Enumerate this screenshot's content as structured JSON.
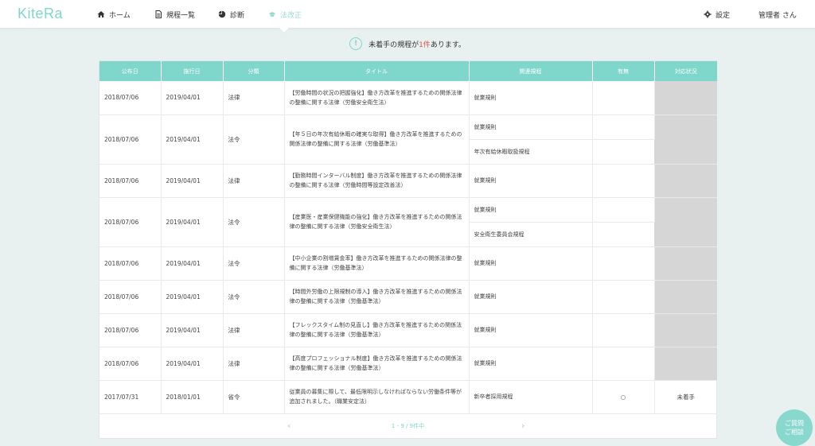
{
  "app": {
    "logo": "KiteRa"
  },
  "nav": {
    "home": "ホーム",
    "list": "規程一覧",
    "diagnosis": "診断",
    "law": "法改正",
    "settings": "設定",
    "user": "管理者 さん"
  },
  "notice": {
    "prefix": "未着手の規程が",
    "count": "1件",
    "suffix": "あります。",
    "icon": "!"
  },
  "table": {
    "headers": [
      "公布日",
      "施行日",
      "分類",
      "タイトル",
      "関連規程",
      "有無",
      "対応状況"
    ],
    "rows": [
      {
        "pub": "2018/07/06",
        "eff": "2019/04/01",
        "cat": "法律",
        "title": "【労働時間の状況の把握強化】働き方改革を推進するための関係法律の整備に関する法律（労働安全衛生法）",
        "related": [
          "就業規則"
        ],
        "has": "",
        "status": ""
      },
      {
        "pub": "2018/07/06",
        "eff": "2019/04/01",
        "cat": "法令",
        "title": "【年５日の年次有給休暇の確実な取得】働き方改革を推進するための関係法律の整備に関する法律（労働基準法）",
        "related": [
          "就業規則",
          "年次有給休暇取扱規程"
        ],
        "has": "",
        "status": ""
      },
      {
        "pub": "2018/07/06",
        "eff": "2019/04/01",
        "cat": "法律",
        "title": "【勤務時間インターバル制度】働き方改革を推進するための関係法律の整備に関する法律（労働時間等設定改善法）",
        "related": [
          "就業規則"
        ],
        "has": "",
        "status": ""
      },
      {
        "pub": "2018/07/06",
        "eff": "2019/04/01",
        "cat": "法令",
        "title": "【産業医・産業保健機能の強化】働き方改革を推進するための関係法律の整備に関する法律（労働安全衛生法）",
        "related": [
          "就業規則",
          "安全衛生委員会規程"
        ],
        "has": "",
        "status": ""
      },
      {
        "pub": "2018/07/06",
        "eff": "2019/04/01",
        "cat": "法令",
        "title": "【中小企業の割増賃金率】働き方改革を推進するための関係法律の整備に関する法律（労働基準法）",
        "related": [
          "就業規則"
        ],
        "has": "",
        "status": ""
      },
      {
        "pub": "2018/07/06",
        "eff": "2019/04/01",
        "cat": "法令",
        "title": "【時間外労働の上限規制の導入】働き方改革を推進するための関係法律の整備に関する法律（労働基準法）",
        "related": [
          "就業規則"
        ],
        "has": "",
        "status": ""
      },
      {
        "pub": "2018/07/06",
        "eff": "2019/04/01",
        "cat": "法律",
        "title": "【フレックスタイム制の見直し】働き方改革を推進するための関係法律の整備に関する法律（労働基準法）",
        "related": [
          "就業規則"
        ],
        "has": "",
        "status": ""
      },
      {
        "pub": "2018/07/06",
        "eff": "2019/04/01",
        "cat": "法律",
        "title": "【高度プロフェッショナル制度】働き方改革を推進するための関係法律の整備に関する法律（労働基準法）",
        "related": [
          "就業規則"
        ],
        "has": "",
        "status": ""
      },
      {
        "pub": "2017/07/31",
        "eff": "2018/01/01",
        "cat": "省令",
        "title": "従業員の募集に際して、最低限明示しなければならない労働条件等が追加されました。（職業安定法）",
        "related": [
          "新卒者採用規程"
        ],
        "has": "○",
        "status": "未着手"
      }
    ]
  },
  "pager": {
    "text": "1 - 9 / 9件中",
    "prev": "‹",
    "next": "›"
  },
  "help": {
    "line1": "ご質問",
    "line2": "ご相談"
  },
  "colors": {
    "accent": "#7fd6cb",
    "alert": "#e0504a",
    "bg": "#e8f1ef"
  }
}
